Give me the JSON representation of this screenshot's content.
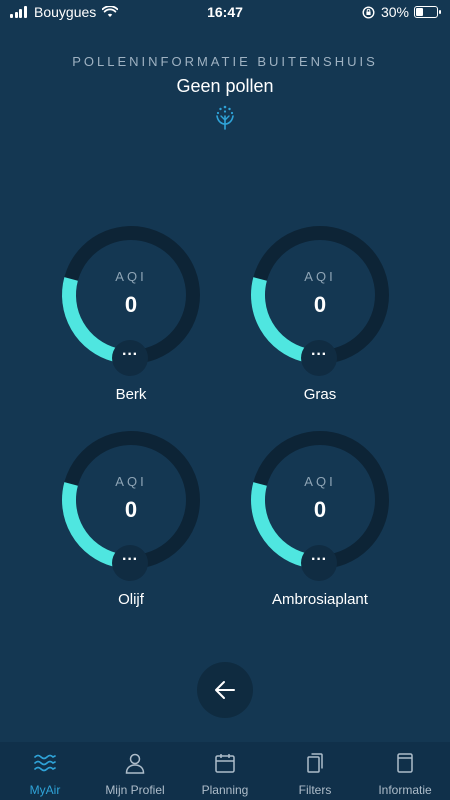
{
  "status_bar": {
    "carrier": "Bouygues",
    "time": "16:47",
    "battery": "30%",
    "battery_level": 0.3
  },
  "header": {
    "subtitle": "POLLENINFORMATIE BUITENSHUIS",
    "title": "Geen pollen",
    "icon": "pollen-icon"
  },
  "gauges": [
    {
      "label": "AQI",
      "value": "0",
      "name": "Berk",
      "more": "···"
    },
    {
      "label": "AQI",
      "value": "0",
      "name": "Gras",
      "more": "···"
    },
    {
      "label": "AQI",
      "value": "0",
      "name": "Olijf",
      "more": "···"
    },
    {
      "label": "AQI",
      "value": "0",
      "name": "Ambrosiaplant",
      "more": "···"
    }
  ],
  "back_button": {
    "icon": "arrow-left-icon"
  },
  "tabs": [
    {
      "label": "MyAir",
      "icon": "waves-icon",
      "active": true
    },
    {
      "label": "Mijn Profiel",
      "icon": "person-icon",
      "active": false
    },
    {
      "label": "Planning",
      "icon": "calendar-icon",
      "active": false
    },
    {
      "label": "Filters",
      "icon": "filters-icon",
      "active": false
    },
    {
      "label": "Informatie",
      "icon": "book-icon",
      "active": false
    }
  ],
  "colors": {
    "background": "#143752",
    "ring_track": "#0d2436",
    "ring_accent": "#4fe6e0",
    "active_tab": "#2fa3d8",
    "tab_text": "#aebdca"
  }
}
